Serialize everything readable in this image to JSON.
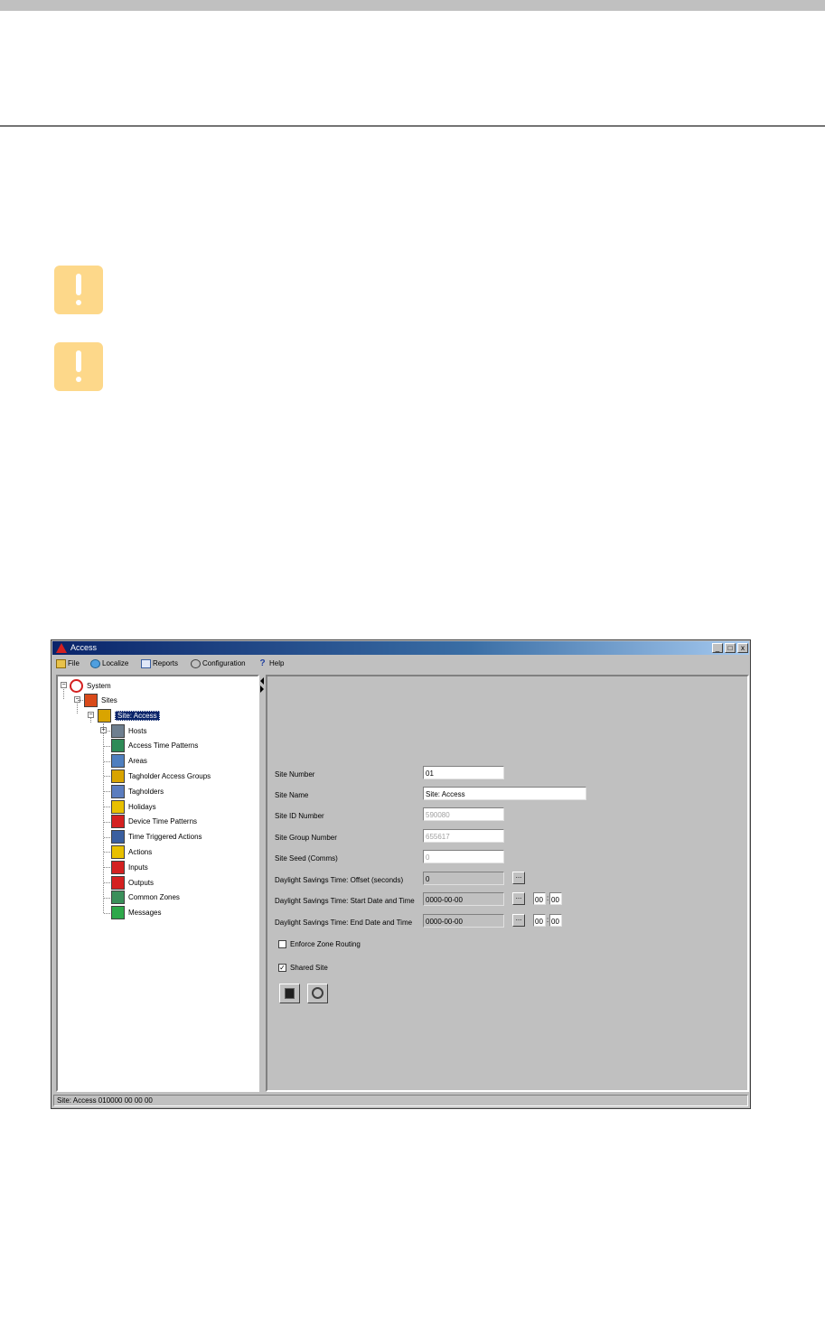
{
  "window": {
    "title": "Access",
    "controls": {
      "minimize": "_",
      "maximize": "□",
      "close": "x"
    }
  },
  "menu": [
    {
      "label": "File",
      "icon": "folder-icon"
    },
    {
      "label": "Localize",
      "icon": "globe-icon"
    },
    {
      "label": "Reports",
      "icon": "report-icon"
    },
    {
      "label": "Configuration",
      "icon": "link-icon"
    },
    {
      "label": "Help",
      "icon": "help-icon"
    }
  ],
  "tree": {
    "root": "System",
    "sites": "Sites",
    "selected": "Site: Access",
    "children": [
      {
        "label": "Hosts",
        "icon": "hosts-icon",
        "color": "#6e7f8f"
      },
      {
        "label": "Access Time Patterns",
        "icon": "access-time-icon",
        "color": "#2e8b57"
      },
      {
        "label": "Areas",
        "icon": "areas-icon",
        "color": "#4f7fbf"
      },
      {
        "label": "Tagholder Access Groups",
        "icon": "access-groups-icon",
        "color": "#d9a400"
      },
      {
        "label": "Tagholders",
        "icon": "tagholders-icon",
        "color": "#5b7dbf"
      },
      {
        "label": "Holidays",
        "icon": "holidays-icon",
        "color": "#e8c000"
      },
      {
        "label": "Device Time Patterns",
        "icon": "device-time-icon",
        "color": "#d42020"
      },
      {
        "label": "Time Triggered Actions",
        "icon": "time-action-icon",
        "color": "#3a5fa0"
      },
      {
        "label": "Actions",
        "icon": "actions-icon",
        "color": "#e8c000"
      },
      {
        "label": "Inputs",
        "icon": "inputs-icon",
        "color": "#d42020"
      },
      {
        "label": "Outputs",
        "icon": "outputs-icon",
        "color": "#d42020"
      },
      {
        "label": "Common Zones",
        "icon": "zones-icon",
        "color": "#3a8f5a"
      },
      {
        "label": "Messages",
        "icon": "messages-icon",
        "color": "#2ea84a"
      }
    ]
  },
  "form": {
    "site_number": {
      "label": "Site Number",
      "value": "01"
    },
    "site_name": {
      "label": "Site Name",
      "value": "Site: Access"
    },
    "site_id": {
      "label": "Site ID Number",
      "value": "590080"
    },
    "site_group": {
      "label": "Site Group Number",
      "value": "655617"
    },
    "site_seed": {
      "label": "Site Seed (Comms)",
      "value": "0"
    },
    "dst_offset": {
      "label": "Daylight Savings Time: Offset (seconds)",
      "value": "0",
      "button": "..."
    },
    "dst_start": {
      "label": "Daylight Savings Time: Start Date and Time",
      "value": "0000-00-00",
      "button": "...",
      "hour": "00",
      "minute": "00"
    },
    "dst_end": {
      "label": "Daylight Savings Time: End Date and Time",
      "value": "0000-00-00",
      "button": "...",
      "hour": "00",
      "minute": "00"
    },
    "enforce_zone": {
      "label": "Enforce Zone Routing",
      "checked": false
    },
    "shared_site": {
      "label": "Shared Site",
      "checked": true,
      "mark": "✓"
    },
    "time_separator": ":"
  },
  "status": "Site: Access 010000 00 00 00"
}
